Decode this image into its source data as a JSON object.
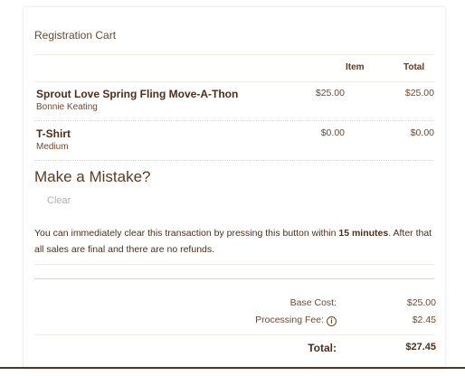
{
  "cart": {
    "title": "Registration Cart",
    "columns": {
      "item": "Item",
      "total": "Total"
    },
    "items": [
      {
        "name": "Sprout Love Spring Fling Move-A-Thon",
        "sub": "Bonnie Keating",
        "item_price": "$25.00",
        "total_price": "$25.00"
      },
      {
        "name": "T-Shirt",
        "sub": "Medium",
        "item_price": "$0.00",
        "total_price": "$0.00"
      }
    ]
  },
  "mistake": {
    "title": "Make a Mistake?",
    "clear_label": "Clear",
    "notice_pre": "You can immediately clear this transaction by pressing this button within ",
    "notice_bold": "15 minutes",
    "notice_post": ". After that all sales are final and there are no refunds."
  },
  "summary": {
    "base_cost_label": "Base Cost:",
    "base_cost_value": "$25.00",
    "processing_fee_label": "Processing Fee:",
    "processing_fee_icon": "info-icon",
    "processing_fee_value": "$2.45",
    "total_label": "Total:",
    "total_value": "$27.45"
  }
}
